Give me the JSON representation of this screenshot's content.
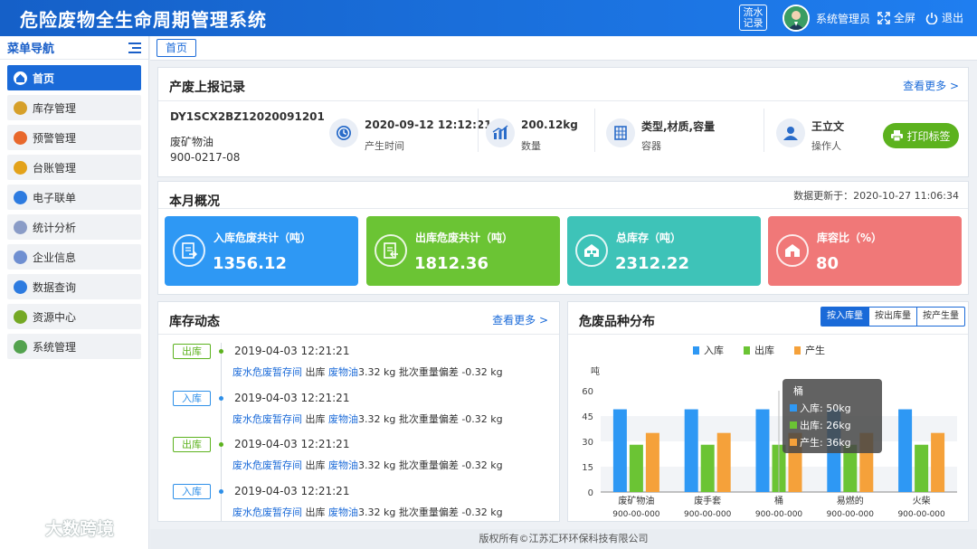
{
  "header": {
    "title": "危险废物全生命周期管理系统",
    "flow_line1": "流水",
    "flow_line2": "记录",
    "user": "系统管理员",
    "fullscreen": "全屏",
    "logout": "退出"
  },
  "sidebar": {
    "title": "菜单导航",
    "items": [
      {
        "label": "首页",
        "icon": "home-icon",
        "color": "#1a6ad8"
      },
      {
        "label": "库存管理",
        "icon": "inventory-icon",
        "color": "#d6a02a"
      },
      {
        "label": "预警管理",
        "icon": "warning-icon",
        "color": "#e8682c"
      },
      {
        "label": "台账管理",
        "icon": "ledger-icon",
        "color": "#e3a21a"
      },
      {
        "label": "电子联单",
        "icon": "document-icon",
        "color": "#2d7be0"
      },
      {
        "label": "统计分析",
        "icon": "statistics-icon",
        "color": "#8a9cc7"
      },
      {
        "label": "企业信息",
        "icon": "enterprise-icon",
        "color": "#6f8fd1"
      },
      {
        "label": "数据查询",
        "icon": "query-icon",
        "color": "#2d7be0"
      },
      {
        "label": "资源中心",
        "icon": "resource-icon",
        "color": "#74a824"
      },
      {
        "label": "系统管理",
        "icon": "settings-icon",
        "color": "#53a24e"
      }
    ]
  },
  "watermark": "大数跨境",
  "tab": "首页",
  "report": {
    "title": "产废上报记录",
    "more": "查看更多 >",
    "code": "DY1SCX2BZ12020091201",
    "name": "废矿物油",
    "number": "900-0217-08",
    "time_value": "2020-09-12 12:12:21",
    "time_label": "产生时间",
    "qty_value": "200.12kg",
    "qty_label": "数量",
    "container_value": "类型,材质,容量",
    "container_label": "容器",
    "operator_value": "王立文",
    "operator_label": "操作人",
    "print": "打印标签"
  },
  "overview": {
    "title": "本月概况",
    "updated": "数据更新于：2020-10-27 11:06:34",
    "cards": [
      {
        "label": "入库危废共计（吨）",
        "value": "1356.12",
        "color": "#2e98f4"
      },
      {
        "label": "出库危废共计（吨）",
        "value": "1812.36",
        "color": "#6bc434"
      },
      {
        "label": "总库存（吨）",
        "value": "2312.22",
        "color": "#3ec3b8"
      },
      {
        "label": "库容比（%）",
        "value": "80",
        "color": "#f07878"
      }
    ]
  },
  "stock": {
    "title": "库存动态",
    "more": "查看更多 >",
    "entries": [
      {
        "type": "出库",
        "kind": "out",
        "time": "2019-04-03   12:21:21",
        "loc": "废水危废暂存间",
        "dir": "出库",
        "waste": "废物油",
        "qty": "3.32 kg",
        "dev": "批次重量偏差 -0.32 kg"
      },
      {
        "type": "入库",
        "kind": "in",
        "time": "2019-04-03   12:21:21",
        "loc": "废水危废暂存间",
        "dir": "出库",
        "waste": "废物油",
        "qty": "3.32 kg",
        "dev": "批次重量偏差 -0.32 kg"
      },
      {
        "type": "出库",
        "kind": "out",
        "time": "2019-04-03   12:21:21",
        "loc": "废水危废暂存间",
        "dir": "出库",
        "waste": "废物油",
        "qty": "3.32 kg",
        "dev": "批次重量偏差 -0.32 kg"
      },
      {
        "type": "入库",
        "kind": "in",
        "time": "2019-04-03   12:21:21",
        "loc": "废水危废暂存间",
        "dir": "出库",
        "waste": "废物油",
        "qty": "3.32 kg",
        "dev": "批次重量偏差 -0.32 kg"
      }
    ]
  },
  "distribution": {
    "title": "危废品种分布",
    "toggles": [
      "按入库量",
      "按出库量",
      "按产生量"
    ],
    "active_toggle": 0
  },
  "chart_data": {
    "type": "bar",
    "ylabel": "吨",
    "ylim": [
      0,
      60
    ],
    "yticks": [
      0,
      15,
      30,
      45,
      60
    ],
    "categories": [
      "废矿物油",
      "废手套",
      "桶",
      "易燃的",
      "火柴"
    ],
    "category_codes": [
      "900-00-000",
      "900-00-000",
      "900-00-000",
      "900-00-000",
      "900-00-000"
    ],
    "series": [
      {
        "name": "入库",
        "color": "#2e98f4",
        "values": [
          49,
          49,
          49,
          49,
          49
        ]
      },
      {
        "name": "出库",
        "color": "#6bc434",
        "values": [
          28,
          28,
          28,
          28,
          28
        ]
      },
      {
        "name": "产生",
        "color": "#f5a13a",
        "values": [
          35,
          35,
          35,
          35,
          35
        ]
      }
    ],
    "legend": "top-center",
    "tooltip": {
      "title": "桶",
      "rows": [
        {
          "label": "入库:  50kg",
          "color": "#2e98f4"
        },
        {
          "label": "出库:  26kg",
          "color": "#6bc434"
        },
        {
          "label": "产生:  36kg",
          "color": "#f5a13a"
        }
      ]
    }
  },
  "footer": "版权所有©江苏汇环环保科技有限公司"
}
